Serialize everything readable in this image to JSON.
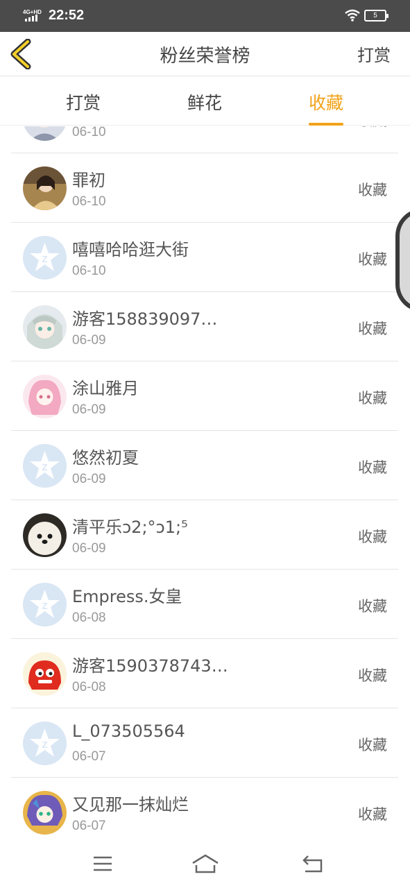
{
  "status": {
    "network": "4G+HD",
    "time": "22:52",
    "battery": "5"
  },
  "header": {
    "title": "粉丝荣誉榜",
    "right_action": "打赏"
  },
  "tabs": [
    {
      "label": "打赏",
      "active": false
    },
    {
      "label": "鲜花",
      "active": false
    },
    {
      "label": "收藏",
      "active": true
    }
  ],
  "accent_color": "#f1a31a",
  "rows": [
    {
      "name": "",
      "date": "06-10",
      "action": "收藏",
      "avatar": "anime-avatar"
    },
    {
      "name": "罪初",
      "date": "06-10",
      "action": "收藏",
      "avatar": "photo-avatar"
    },
    {
      "name": "嘻嘻哈哈逛大街",
      "date": "06-10",
      "action": "收藏",
      "avatar": "default-avatar"
    },
    {
      "name": "游客158839097…",
      "date": "06-09",
      "action": "收藏",
      "avatar": "anime-avatar"
    },
    {
      "name": "涂山雅月",
      "date": "06-09",
      "action": "收藏",
      "avatar": "pink-anime-avatar"
    },
    {
      "name": "悠然初夏",
      "date": "06-09",
      "action": "收藏",
      "avatar": "default-avatar"
    },
    {
      "name": "清平乐ↄ2;°ↄ1;⁵",
      "date": "06-09",
      "action": "收藏",
      "avatar": "dog-avatar"
    },
    {
      "name": "Empress.女皇",
      "date": "06-08",
      "action": "收藏",
      "avatar": "default-avatar"
    },
    {
      "name": "游客1590378743…",
      "date": "06-08",
      "action": "收藏",
      "avatar": "red-mascot-avatar"
    },
    {
      "name": "L_073505564",
      "date": "06-07",
      "action": "收藏",
      "avatar": "default-avatar"
    },
    {
      "name": "又见那一抹灿烂",
      "date": "06-07",
      "action": "收藏",
      "avatar": "anime-avatar"
    }
  ],
  "bottom_nav": [
    "menu-icon",
    "home-icon",
    "back-icon"
  ]
}
